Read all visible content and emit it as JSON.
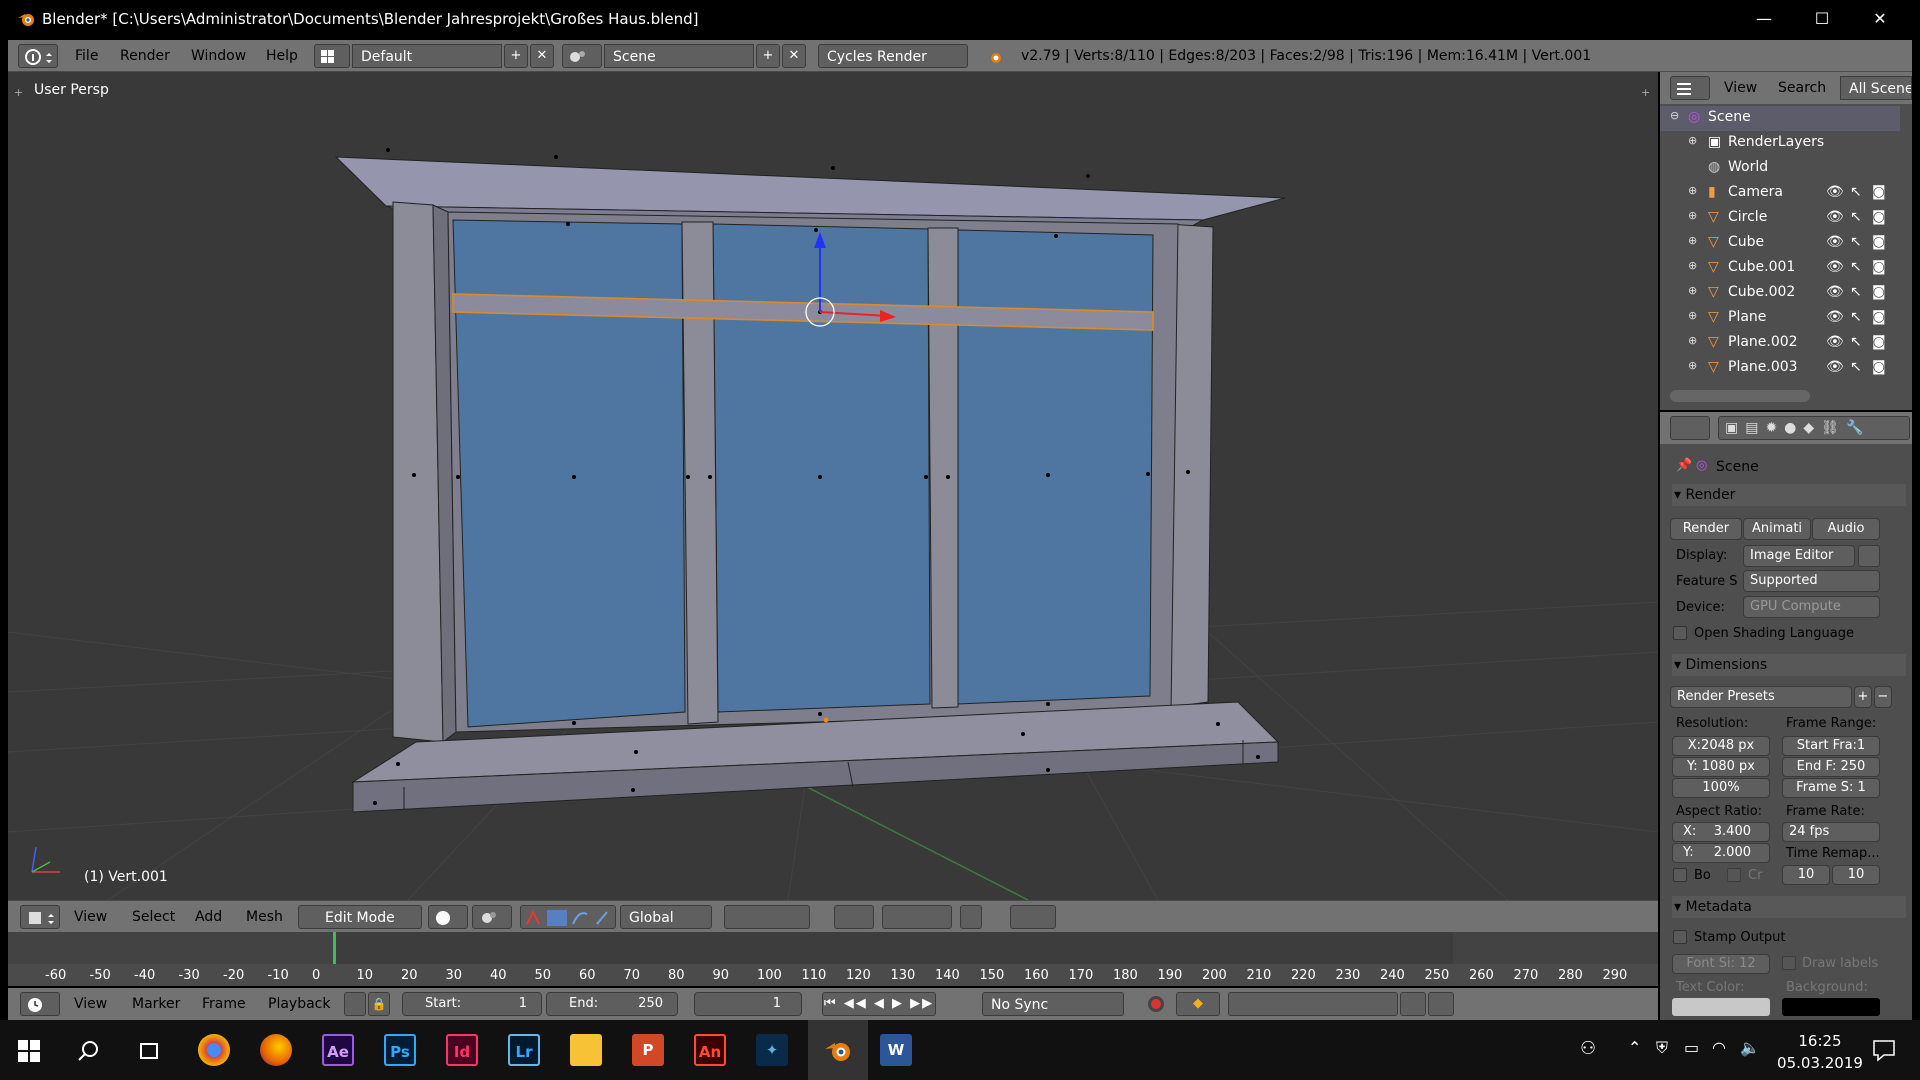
{
  "window": {
    "title": "Blender* [C:\\Users\\Administrator\\Documents\\Blender Jahresprojekt\\Großes Haus.blend]",
    "minimize": "—",
    "maximize": "☐",
    "close": "✕"
  },
  "info_header": {
    "menus": [
      "File",
      "Render",
      "Window",
      "Help"
    ],
    "layout": "Default",
    "scene": "Scene",
    "engine": "Cycles Render",
    "stats": "v2.79 | Verts:8/110 | Edges:8/203 | Faces:2/98 | Tris:196 | Mem:16.41M | Vert.001"
  },
  "viewport": {
    "view_label": "User Persp",
    "object_label": "(1) Vert.001",
    "accent_glass": "#4f76a0",
    "accent_frame": "#8e8c9c"
  },
  "viewport_header": {
    "menus": [
      "View",
      "Select",
      "Add",
      "Mesh"
    ],
    "mode": "Edit Mode",
    "orientation": "Global"
  },
  "timeline": {
    "ticks": [
      "-60",
      "-50",
      "-40",
      "-30",
      "-20",
      "-10",
      "0",
      "10",
      "20",
      "30",
      "40",
      "50",
      "60",
      "70",
      "80",
      "90",
      "100",
      "110",
      "120",
      "130",
      "140",
      "150",
      "160",
      "170",
      "180",
      "190",
      "200",
      "210",
      "220",
      "230",
      "240",
      "250",
      "260",
      "270",
      "280",
      "290"
    ],
    "menus": [
      "View",
      "Marker",
      "Frame",
      "Playback"
    ],
    "start_label": "Start:",
    "start_value": "1",
    "end_label": "End:",
    "end_value": "250",
    "current_frame": "1",
    "sync": "No Sync"
  },
  "outliner": {
    "menus": [
      "View",
      "Search"
    ],
    "filter": "All Scenes",
    "items": [
      {
        "label": "Scene",
        "level": 0
      },
      {
        "label": "RenderLayers",
        "level": 1
      },
      {
        "label": "World",
        "level": 1
      },
      {
        "label": "Camera",
        "level": 1
      },
      {
        "label": "Circle",
        "level": 1
      },
      {
        "label": "Cube",
        "level": 1
      },
      {
        "label": "Cube.001",
        "level": 1
      },
      {
        "label": "Cube.002",
        "level": 1
      },
      {
        "label": "Plane",
        "level": 1
      },
      {
        "label": "Plane.002",
        "level": 1
      },
      {
        "label": "Plane.003",
        "level": 1
      }
    ]
  },
  "properties": {
    "context": "Scene",
    "render_section": "Render",
    "render_buttons": [
      "Render",
      "Animati",
      "Audio"
    ],
    "display_label": "Display:",
    "display_value": "Image Editor",
    "feature_label": "Feature S",
    "feature_value": "Supported",
    "device_label": "Device:",
    "device_value": "GPU Compute",
    "osl_label": "Open Shading Language",
    "dimensions_section": "Dimensions",
    "render_presets": "Render Presets",
    "resolution_label": "Resolution:",
    "res_x": "X:2048 px",
    "res_y": "Y: 1080 px",
    "res_pct": "100%",
    "frame_range_label": "Frame Range:",
    "start_frame": "Start Fra:1",
    "end_frame": "End F: 250",
    "frame_step": "Frame S: 1",
    "aspect_label": "Aspect Ratio:",
    "aspect_x_label": "X:",
    "aspect_x": "3.400",
    "aspect_y_label": "Y:",
    "aspect_y": "2.000",
    "frame_rate_label": "Frame Rate:",
    "frame_rate": "24 fps",
    "time_remap_label": "Time Remap...",
    "remap_old": "10",
    "remap_new": "10",
    "border_label": "Bo",
    "crop_label": "Cr",
    "metadata_section": "Metadata",
    "stamp_label": "Stamp Output",
    "font_size": "Font Si: 12",
    "draw_labels": "Draw labels",
    "text_color_label": "Text Color:",
    "background_label": "Background:"
  },
  "taskbar": {
    "apps": [
      "Ae",
      "Ps",
      "Id",
      "Lr",
      "An"
    ],
    "time": "16:25",
    "date": "05.03.2019"
  }
}
